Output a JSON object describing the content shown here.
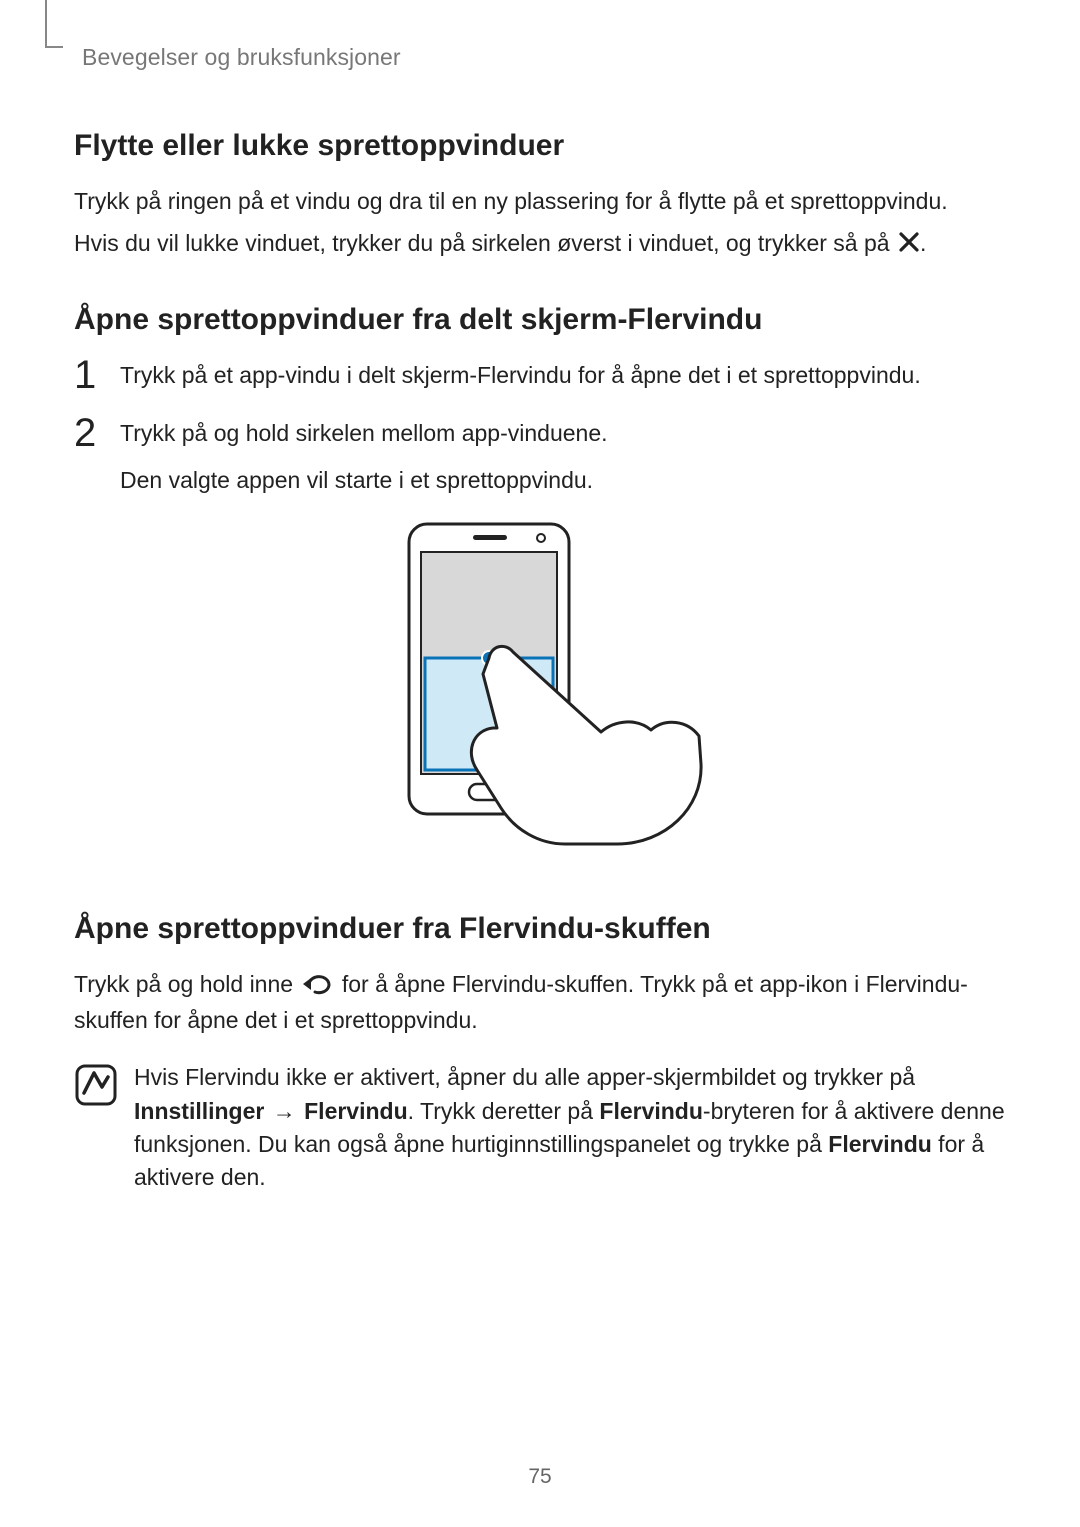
{
  "header": {
    "section_title": "Bevegelser og bruksfunksjoner"
  },
  "sections": {
    "s1": {
      "heading": "Flytte eller lukke sprettoppvinduer",
      "p1": "Trykk på ringen på et vindu og dra til en ny plassering for å flytte på et sprettoppvindu.",
      "p2a": "Hvis du vil lukke vinduet, trykker du på sirkelen øverst i vinduet, og trykker så på ",
      "p2b": "."
    },
    "s2": {
      "heading": "Åpne sprettoppvinduer fra delt skjerm-Flervindu",
      "items": [
        {
          "num": "1",
          "line1": "Trykk på et app-vindu i delt skjerm-Flervindu for å åpne det i et sprettoppvindu."
        },
        {
          "num": "2",
          "line1": "Trykk på og hold sirkelen mellom app-vinduene.",
          "line2": "Den valgte appen vil starte i et sprettoppvindu."
        }
      ]
    },
    "s3": {
      "heading": "Åpne sprettoppvinduer fra Flervindu-skuffen",
      "p1a": "Trykk på og hold inne ",
      "p1b": " for å åpne Flervindu-skuffen. Trykk på et app-ikon i Flervindu-skuffen for åpne det i et sprettoppvindu.",
      "note": {
        "t1": "Hvis Flervindu ikke er aktivert, åpner du alle apper-skjermbildet og trykker på ",
        "b1": "Innstillinger",
        "arrow": " → ",
        "b2": "Flervindu",
        "t2": ". Trykk deretter på ",
        "b3": "Flervindu",
        "t3": "-bryteren for å aktivere denne funksjonen. Du kan også åpne hurtiginnstillingspanelet og trykke på ",
        "b4": "Flervindu",
        "t4": " for å aktivere den."
      }
    }
  },
  "page_number": "75"
}
